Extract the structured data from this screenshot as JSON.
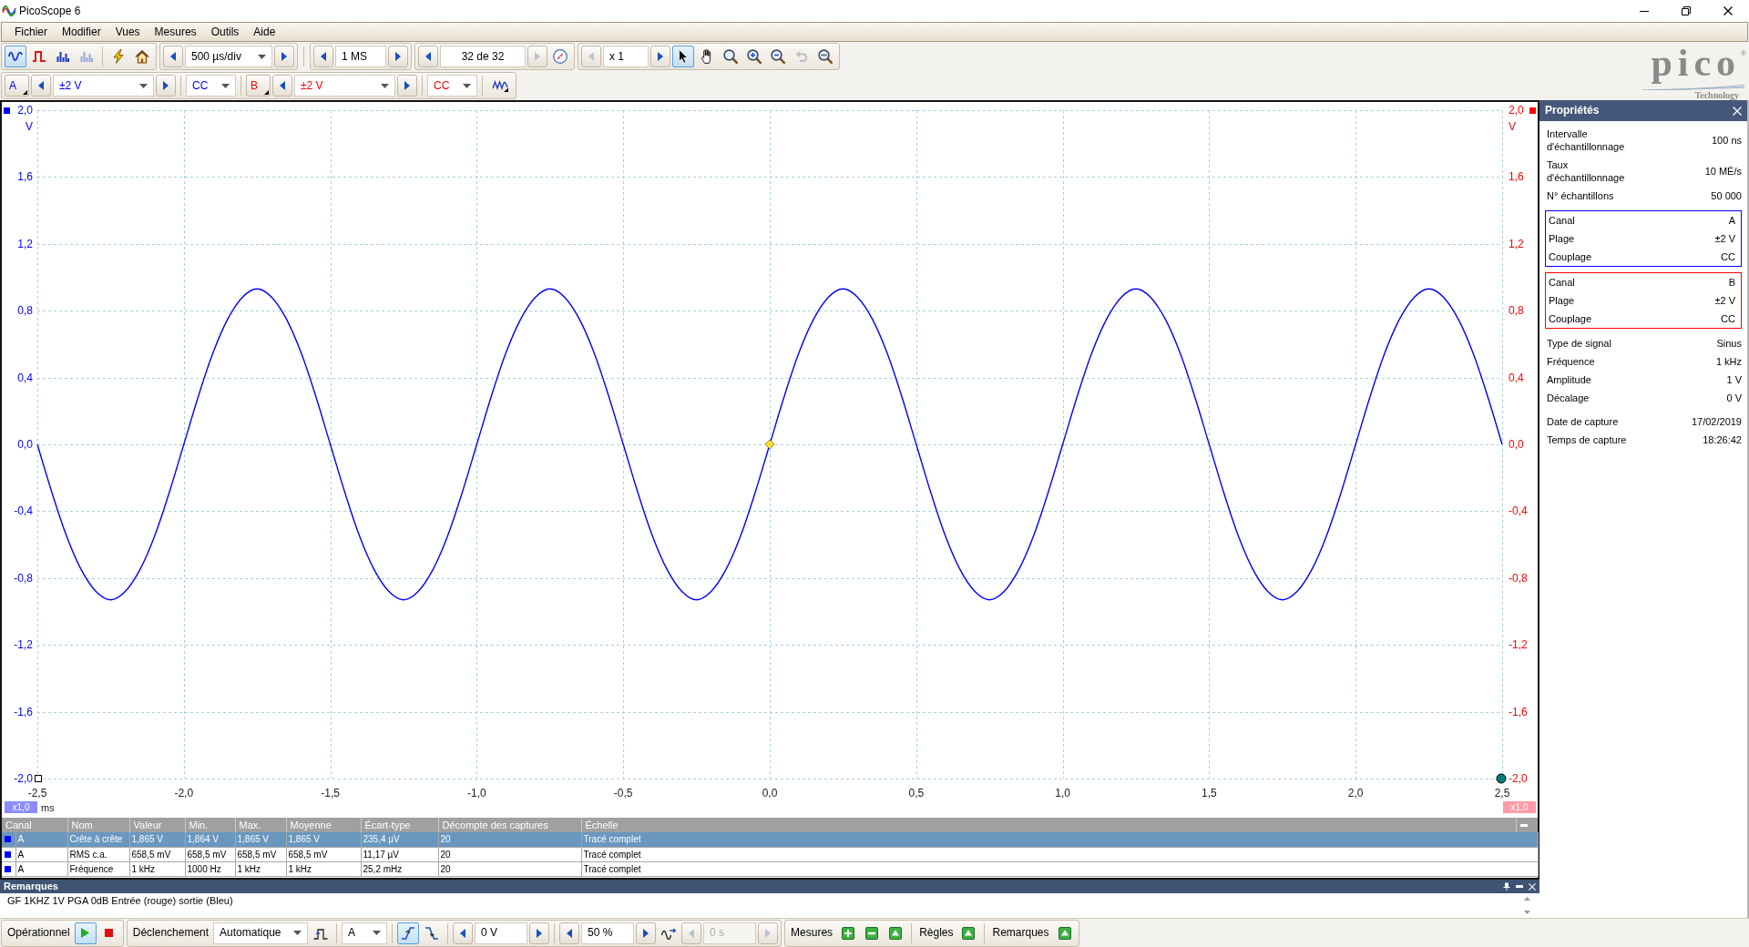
{
  "window": {
    "title": "PicoScope 6"
  },
  "menu": [
    "Fichier",
    "Modifier",
    "Vues",
    "Mesures",
    "Outils",
    "Aide"
  ],
  "toolbar": {
    "modes": [
      {
        "kind": "scope",
        "selected": true,
        "disabled": false
      },
      {
        "kind": "persistence",
        "selected": false,
        "disabled": false
      },
      {
        "kind": "spectrum",
        "selected": false,
        "disabled": false
      },
      {
        "kind": "spectrum",
        "selected": false,
        "disabled": true
      }
    ],
    "setup_buttons": [
      {
        "kind": "auto-setup"
      },
      {
        "kind": "default-setup"
      }
    ],
    "timebase": {
      "kind": "dropdown",
      "value": "500 µs/div",
      "disabled": false,
      "prev_disabled": false,
      "next_disabled": false
    },
    "samples": {
      "kind": "field",
      "value": "1 MS",
      "disabled": false,
      "prev_disabled": false,
      "next_disabled": false
    },
    "buffer": {
      "kind": "field",
      "value": "32 de 32",
      "disabled": false,
      "prev_disabled": false,
      "next_disabled": true
    },
    "zoom": {
      "kind": "field",
      "value": "x 1",
      "disabled": false,
      "prev_disabled": true,
      "next_disabled": false
    },
    "tools": [
      {
        "kind": "pointer",
        "selected": true,
        "disabled": false
      },
      {
        "kind": "hand",
        "selected": false,
        "disabled": false
      },
      {
        "kind": "zoom-area",
        "selected": false,
        "disabled": false
      },
      {
        "kind": "zoom-in",
        "selected": false,
        "disabled": false
      },
      {
        "kind": "zoom-out",
        "selected": false,
        "disabled": false
      },
      {
        "kind": "undo",
        "selected": false,
        "disabled": true
      },
      {
        "kind": "zoom-fit",
        "selected": false,
        "disabled": false
      }
    ]
  },
  "channels": [
    {
      "name": "A",
      "color": "#0000ff",
      "range": "±2 V",
      "coupling": "CC"
    },
    {
      "name": "B",
      "color": "#ff0000",
      "range": "±2 V",
      "coupling": "CC"
    }
  ],
  "logo": {
    "name": "pico",
    "mark": "®",
    "tagline": "Technology"
  },
  "plot": {
    "chart_data": {
      "type": "line",
      "grid": true,
      "xlabel": "ms",
      "ylabel": "V",
      "xlim": [
        -2.5,
        2.5
      ],
      "ylim": [
        -2,
        2
      ],
      "xticks": [
        {
          "value": -2.5,
          "label": "-2,5"
        },
        {
          "value": -2,
          "label": "-2,0"
        },
        {
          "value": -1.5,
          "label": "-1,5"
        },
        {
          "value": -1,
          "label": "-1,0"
        },
        {
          "value": -0.5,
          "label": "-0,5"
        },
        {
          "value": 0,
          "label": "0,0"
        },
        {
          "value": 0.5,
          "label": "0,5"
        },
        {
          "value": 1,
          "label": "1,0"
        },
        {
          "value": 1.5,
          "label": "1,5"
        },
        {
          "value": 2,
          "label": "2,0"
        },
        {
          "value": 2.5,
          "label": "2,5"
        }
      ],
      "yticks": [
        {
          "value": 2,
          "label": "2,0"
        },
        {
          "value": 1.6,
          "label": "1,6"
        },
        {
          "value": 1.2,
          "label": "1,2"
        },
        {
          "value": 0.8,
          "label": "0,8"
        },
        {
          "value": 0.4,
          "label": "0,4"
        },
        {
          "value": 0,
          "label": "0,0"
        },
        {
          "value": -0.4,
          "label": "-0,4"
        },
        {
          "value": -0.8,
          "label": "-0,8"
        },
        {
          "value": -1.2,
          "label": "-1,2"
        },
        {
          "value": -1.6,
          "label": "-1,6"
        },
        {
          "value": -2,
          "label": "-2,0"
        }
      ],
      "x": [
        -2.5,
        -2.45,
        -2.4,
        -2.35,
        -2.3,
        -2.25,
        -2.2,
        -2.15,
        -2.1,
        -2.05,
        -2,
        -1.95,
        -1.9,
        -1.85,
        -1.8,
        -1.75,
        -1.7,
        -1.65,
        -1.6,
        -1.55,
        -1.5,
        -1.45,
        -1.4,
        -1.35,
        -1.3,
        -1.25,
        -1.2,
        -1.15,
        -1.1,
        -1.05,
        -1,
        -0.95,
        -0.9,
        -0.85,
        -0.8,
        -0.75,
        -0.7,
        -0.65,
        -0.6,
        -0.55,
        -0.5,
        -0.45,
        -0.4,
        -0.35,
        -0.3,
        -0.25,
        -0.2,
        -0.15,
        -0.1,
        -0.05,
        0,
        0.05,
        0.1,
        0.15,
        0.2,
        0.25,
        0.3,
        0.35,
        0.4,
        0.45,
        0.5,
        0.55,
        0.6,
        0.65,
        0.7,
        0.75,
        0.8,
        0.85,
        0.9,
        0.95,
        1,
        1.05,
        1.1,
        1.15,
        1.2,
        1.25,
        1.3,
        1.35,
        1.4,
        1.45,
        1.5,
        1.55,
        1.6,
        1.65,
        1.7,
        1.75,
        1.8,
        1.85,
        1.9,
        1.95,
        2,
        2.05,
        2.1,
        2.15,
        2.2,
        2.25,
        2.3,
        2.35,
        2.4,
        2.45,
        2.5
      ],
      "series": [
        {
          "color": "#0000ff",
          "values": [
            0,
            -0.29,
            -0.55,
            -0.75,
            -0.88,
            -0.93,
            -0.88,
            -0.75,
            -0.55,
            -0.29,
            0,
            0.29,
            0.55,
            0.75,
            0.88,
            0.93,
            0.88,
            0.75,
            0.55,
            0.29,
            0,
            -0.29,
            -0.55,
            -0.75,
            -0.88,
            -0.93,
            -0.88,
            -0.75,
            -0.55,
            -0.29,
            0,
            0.29,
            0.55,
            0.75,
            0.88,
            0.93,
            0.88,
            0.75,
            0.55,
            0.29,
            0,
            -0.29,
            -0.55,
            -0.75,
            -0.88,
            -0.93,
            -0.88,
            -0.75,
            -0.55,
            -0.29,
            0,
            0.29,
            0.55,
            0.75,
            0.88,
            0.93,
            0.88,
            0.75,
            0.55,
            0.29,
            0,
            -0.29,
            -0.55,
            -0.75,
            -0.88,
            -0.93,
            -0.88,
            -0.75,
            -0.55,
            -0.29,
            0,
            0.29,
            0.55,
            0.75,
            0.88,
            0.93,
            0.88,
            0.75,
            0.55,
            0.29,
            0,
            -0.29,
            -0.55,
            -0.75,
            -0.88,
            -0.93,
            -0.88,
            -0.75,
            -0.55,
            -0.29,
            0,
            0.29,
            0.55,
            0.75,
            0.88,
            0.93,
            0.88,
            0.75,
            0.55,
            0.29,
            0
          ]
        }
      ]
    },
    "right_axis": {
      "unit": "V",
      "ticks": [
        "2,0",
        "1,6",
        "1,2",
        "0,8",
        "0,4",
        "0,0",
        "-0,4",
        "-0,8",
        "-1,2",
        "-1,6",
        "-2,0"
      ]
    },
    "scale_badges": [
      "x1,0",
      "x1,0"
    ]
  },
  "measurements": {
    "columns": [
      "Canal",
      "Nom",
      "Valeur",
      "Min.",
      "Max.",
      "Moyenne",
      "Écart-type",
      "Décompte des captures",
      "Échelle"
    ],
    "rows": [
      {
        "selected": true,
        "color": "#0000ff",
        "cells": [
          "A",
          "Crête à crête",
          "1,865 V",
          "1,864 V",
          "1,865 V",
          "1,865 V",
          "235,4 µV",
          "20",
          "Tracé complet"
        ]
      },
      {
        "selected": false,
        "color": "#0000ff",
        "cells": [
          "A",
          "RMS c.a.",
          "658,5 mV",
          "658,5 mV",
          "658,5 mV",
          "658,5 mV",
          "11,17 µV",
          "20",
          "Tracé complet"
        ]
      },
      {
        "selected": false,
        "color": "#0000ff",
        "cells": [
          "A",
          "Fréquence",
          "1 kHz",
          "1000 Hz",
          "1 kHz",
          "1 kHz",
          "25,2 mHz",
          "20",
          "Tracé complet"
        ]
      }
    ]
  },
  "remarks": {
    "title": "Remarques",
    "text": "GF 1KHZ 1V PGA 0dB Entrée (rouge) sortie (Bleu)"
  },
  "properties": {
    "title": "Propriétés",
    "sections": [
      {
        "kind": "plain",
        "rows": [
          {
            "label": "Intervalle d'échantillonnage",
            "value": "100 ns"
          },
          {
            "label": "Taux d'échantillonnage",
            "value": "10 MÉ/s"
          },
          {
            "label": "N° échantillons",
            "value": "50 000"
          }
        ]
      },
      {
        "kind": "channel",
        "color": "#0000ff",
        "rows": [
          {
            "label": "Canal",
            "value": "A"
          },
          {
            "label": "Plage",
            "value": "±2 V"
          },
          {
            "label": "Couplage",
            "value": "CC"
          }
        ]
      },
      {
        "kind": "channel",
        "color": "#ff0000",
        "rows": [
          {
            "label": "Canal",
            "value": "B"
          },
          {
            "label": "Plage",
            "value": "±2 V"
          },
          {
            "label": "Couplage",
            "value": "CC"
          }
        ]
      },
      {
        "kind": "plain",
        "rows": [
          {
            "label": "Type de signal",
            "value": "Sinus"
          },
          {
            "label": "Fréquence",
            "value": "1 kHz"
          },
          {
            "label": "Amplitude",
            "value": "1 V"
          },
          {
            "label": "Décalage",
            "value": "0 V"
          }
        ]
      },
      {
        "kind": "plain",
        "rows": [
          {
            "label": "Date de capture",
            "value": "17/02/2019"
          },
          {
            "label": "Temps de capture",
            "value": "18:26:42"
          }
        ]
      }
    ]
  },
  "status_bar": {
    "run": {
      "label": "Opérationnel",
      "running": true
    },
    "trigger": {
      "label": "Déclenchement",
      "mode": "Automatique",
      "source": "A",
      "edges": [
        {
          "kind": "rising",
          "selected": true
        },
        {
          "kind": "falling",
          "selected": false
        }
      ]
    },
    "threshold": {
      "kind": "field",
      "value": "0 V",
      "disabled": false,
      "prev_disabled": false,
      "next_disabled": false
    },
    "pretrigger": {
      "kind": "field",
      "value": "50 %",
      "disabled": false,
      "prev_disabled": false,
      "next_disabled": false
    },
    "delay": {
      "kind": "field",
      "value": "0 s",
      "disabled": true,
      "prev_disabled": true,
      "next_disabled": true
    },
    "measurements_label": "Mesures",
    "rulers_label": "Règles",
    "remarks_label": "Remarques"
  }
}
